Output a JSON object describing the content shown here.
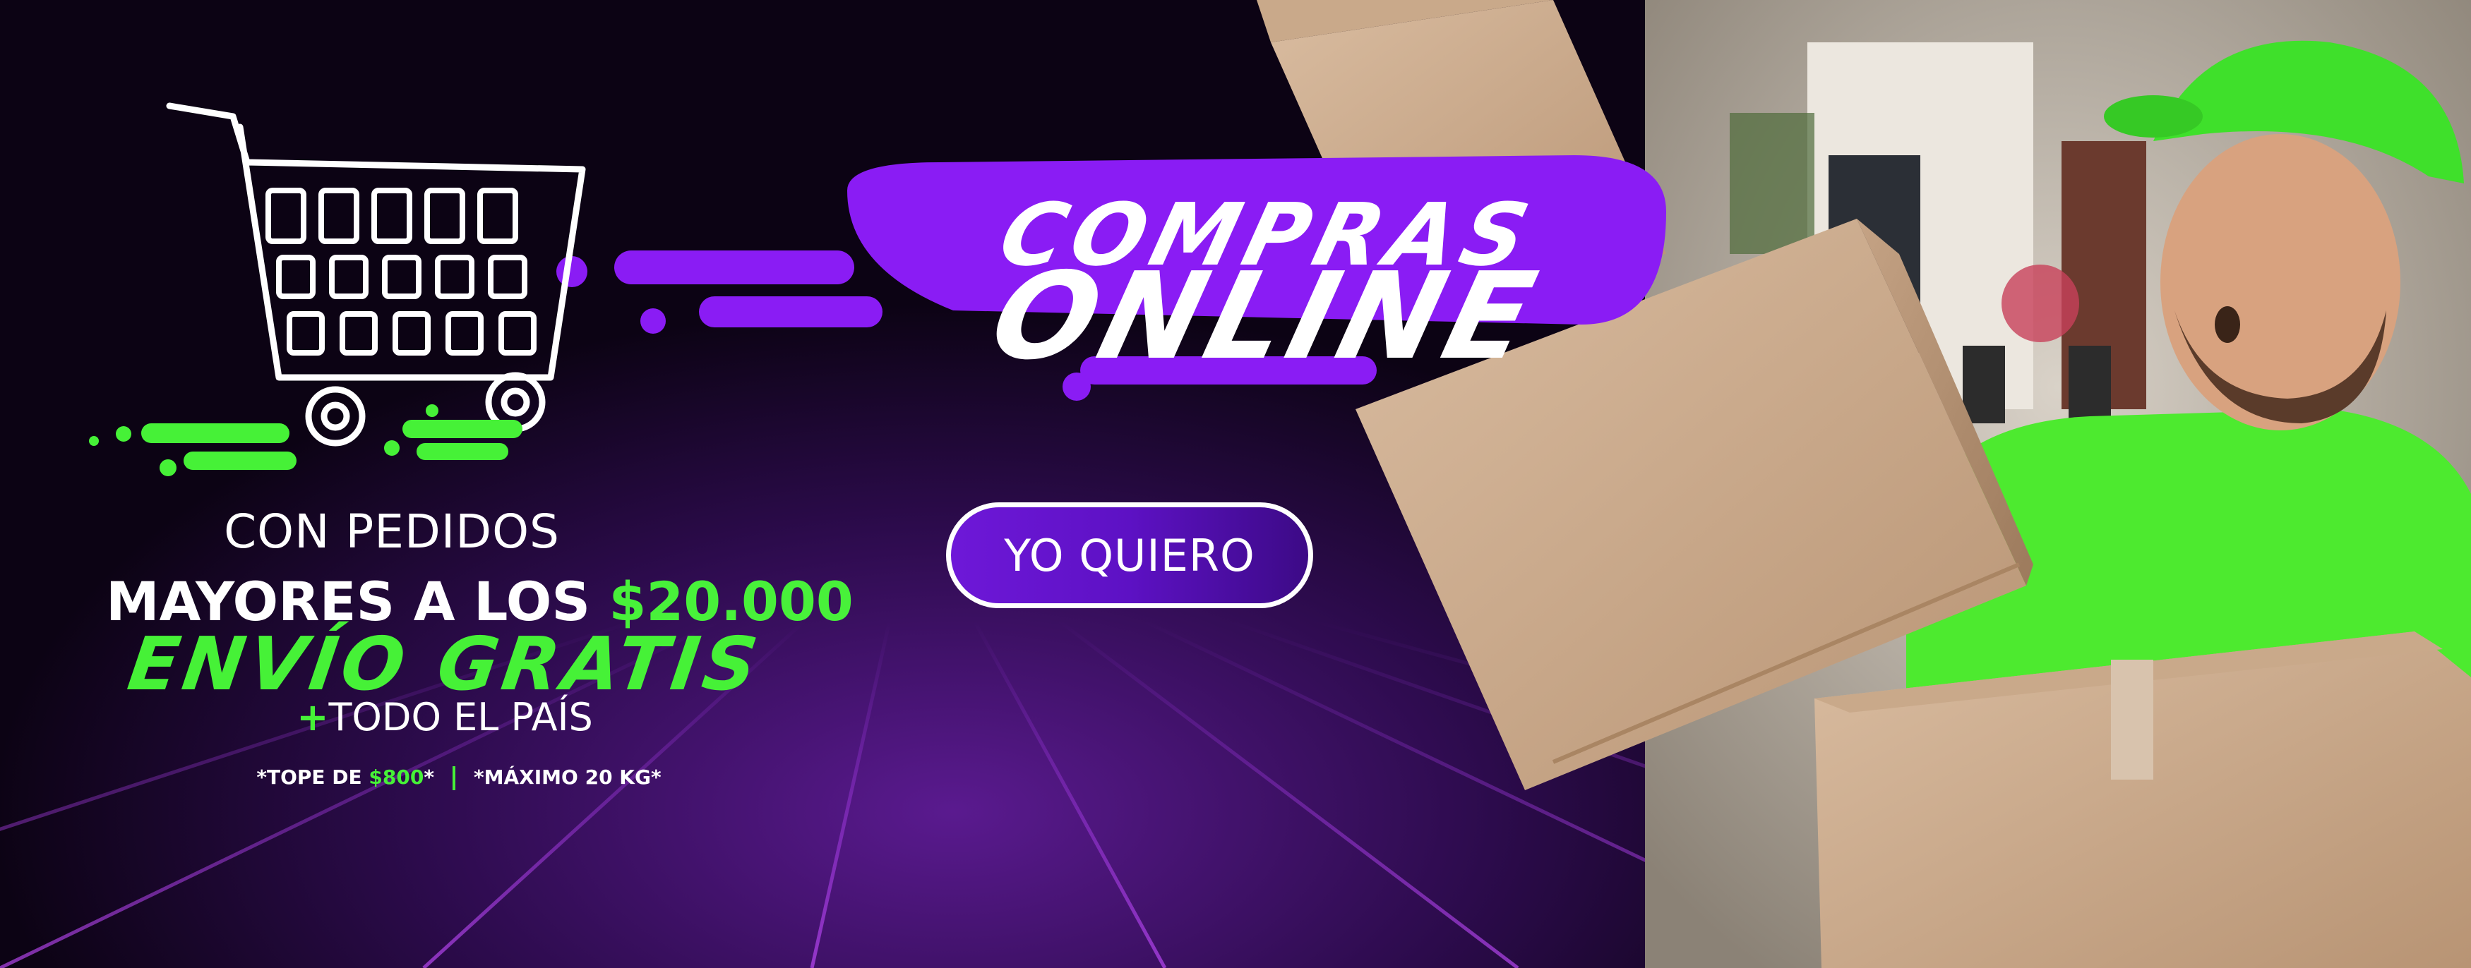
{
  "banner": {
    "headline_top": "COMPRAS",
    "headline_bottom": "ONLINE",
    "cta_label": "YO QUIERO",
    "condition_line1": "CON PEDIDOS",
    "condition_line2_prefix": "MAYORES A LOS ",
    "condition_amount": "$20.000",
    "free_shipping": "ENVÍO GRATIS",
    "coverage_plus": "+",
    "coverage": "TODO EL PAÍS",
    "fine_print_cap_prefix": "*TOPE DE ",
    "fine_print_cap_amount": "$800",
    "fine_print_cap_suffix": "*",
    "fine_print_weight": "*MÁXIMO 20 KG*"
  },
  "icons": {
    "cart": "shopping-cart-icon"
  },
  "colors": {
    "accent_purple": "#8a1cf4",
    "accent_green": "#46f137",
    "background": "#1a0830",
    "cta_fill": "#5d11c4"
  }
}
